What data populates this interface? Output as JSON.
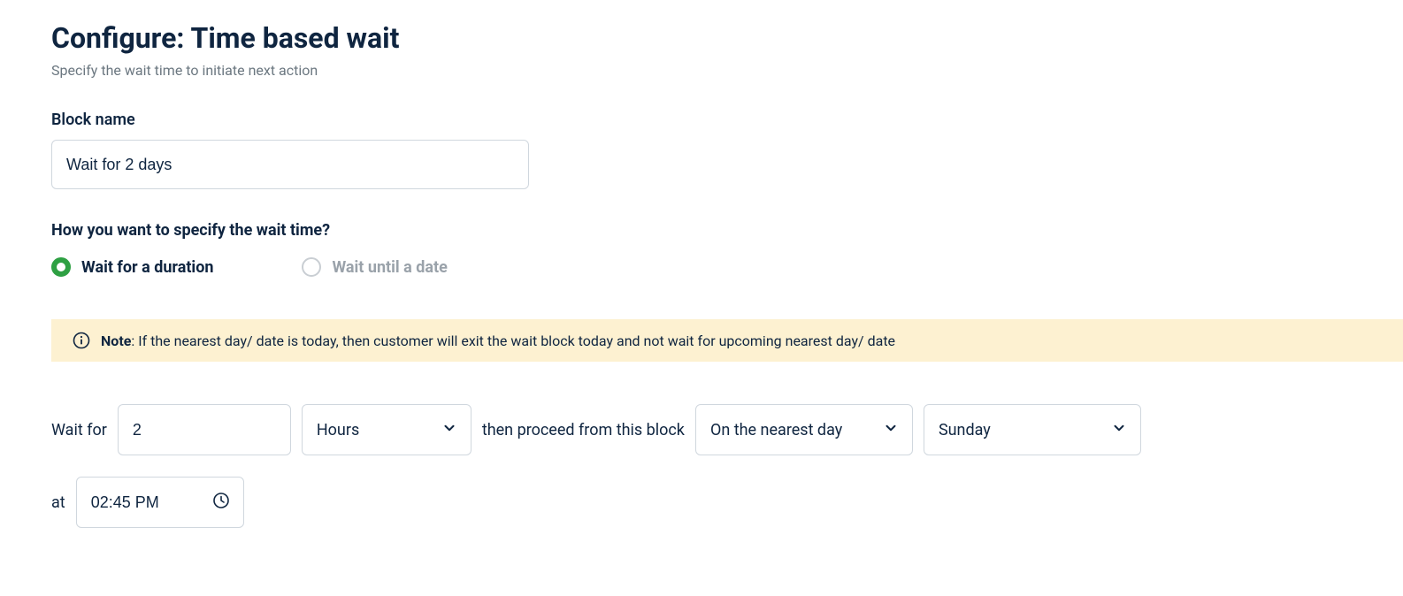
{
  "header": {
    "title": "Configure: Time based wait",
    "subtitle": "Specify the wait time to initiate next action"
  },
  "blockName": {
    "label": "Block name",
    "value": "Wait for 2 days"
  },
  "waitSpec": {
    "question": "How you want to specify the wait time?",
    "options": {
      "duration": "Wait for a duration",
      "untilDate": "Wait until a date"
    },
    "selected": "duration"
  },
  "note": {
    "label": "Note",
    "text": ": If the nearest day/ date is today, then customer will exit the wait block today and not wait for upcoming nearest day/ date"
  },
  "duration": {
    "waitForLabel": "Wait for",
    "amount": "2",
    "unit": "Hours",
    "thenProceedLabel": "then proceed from this block",
    "proceedMode": "On the nearest day",
    "day": "Sunday",
    "atLabel": "at",
    "time": "02:45 PM"
  }
}
